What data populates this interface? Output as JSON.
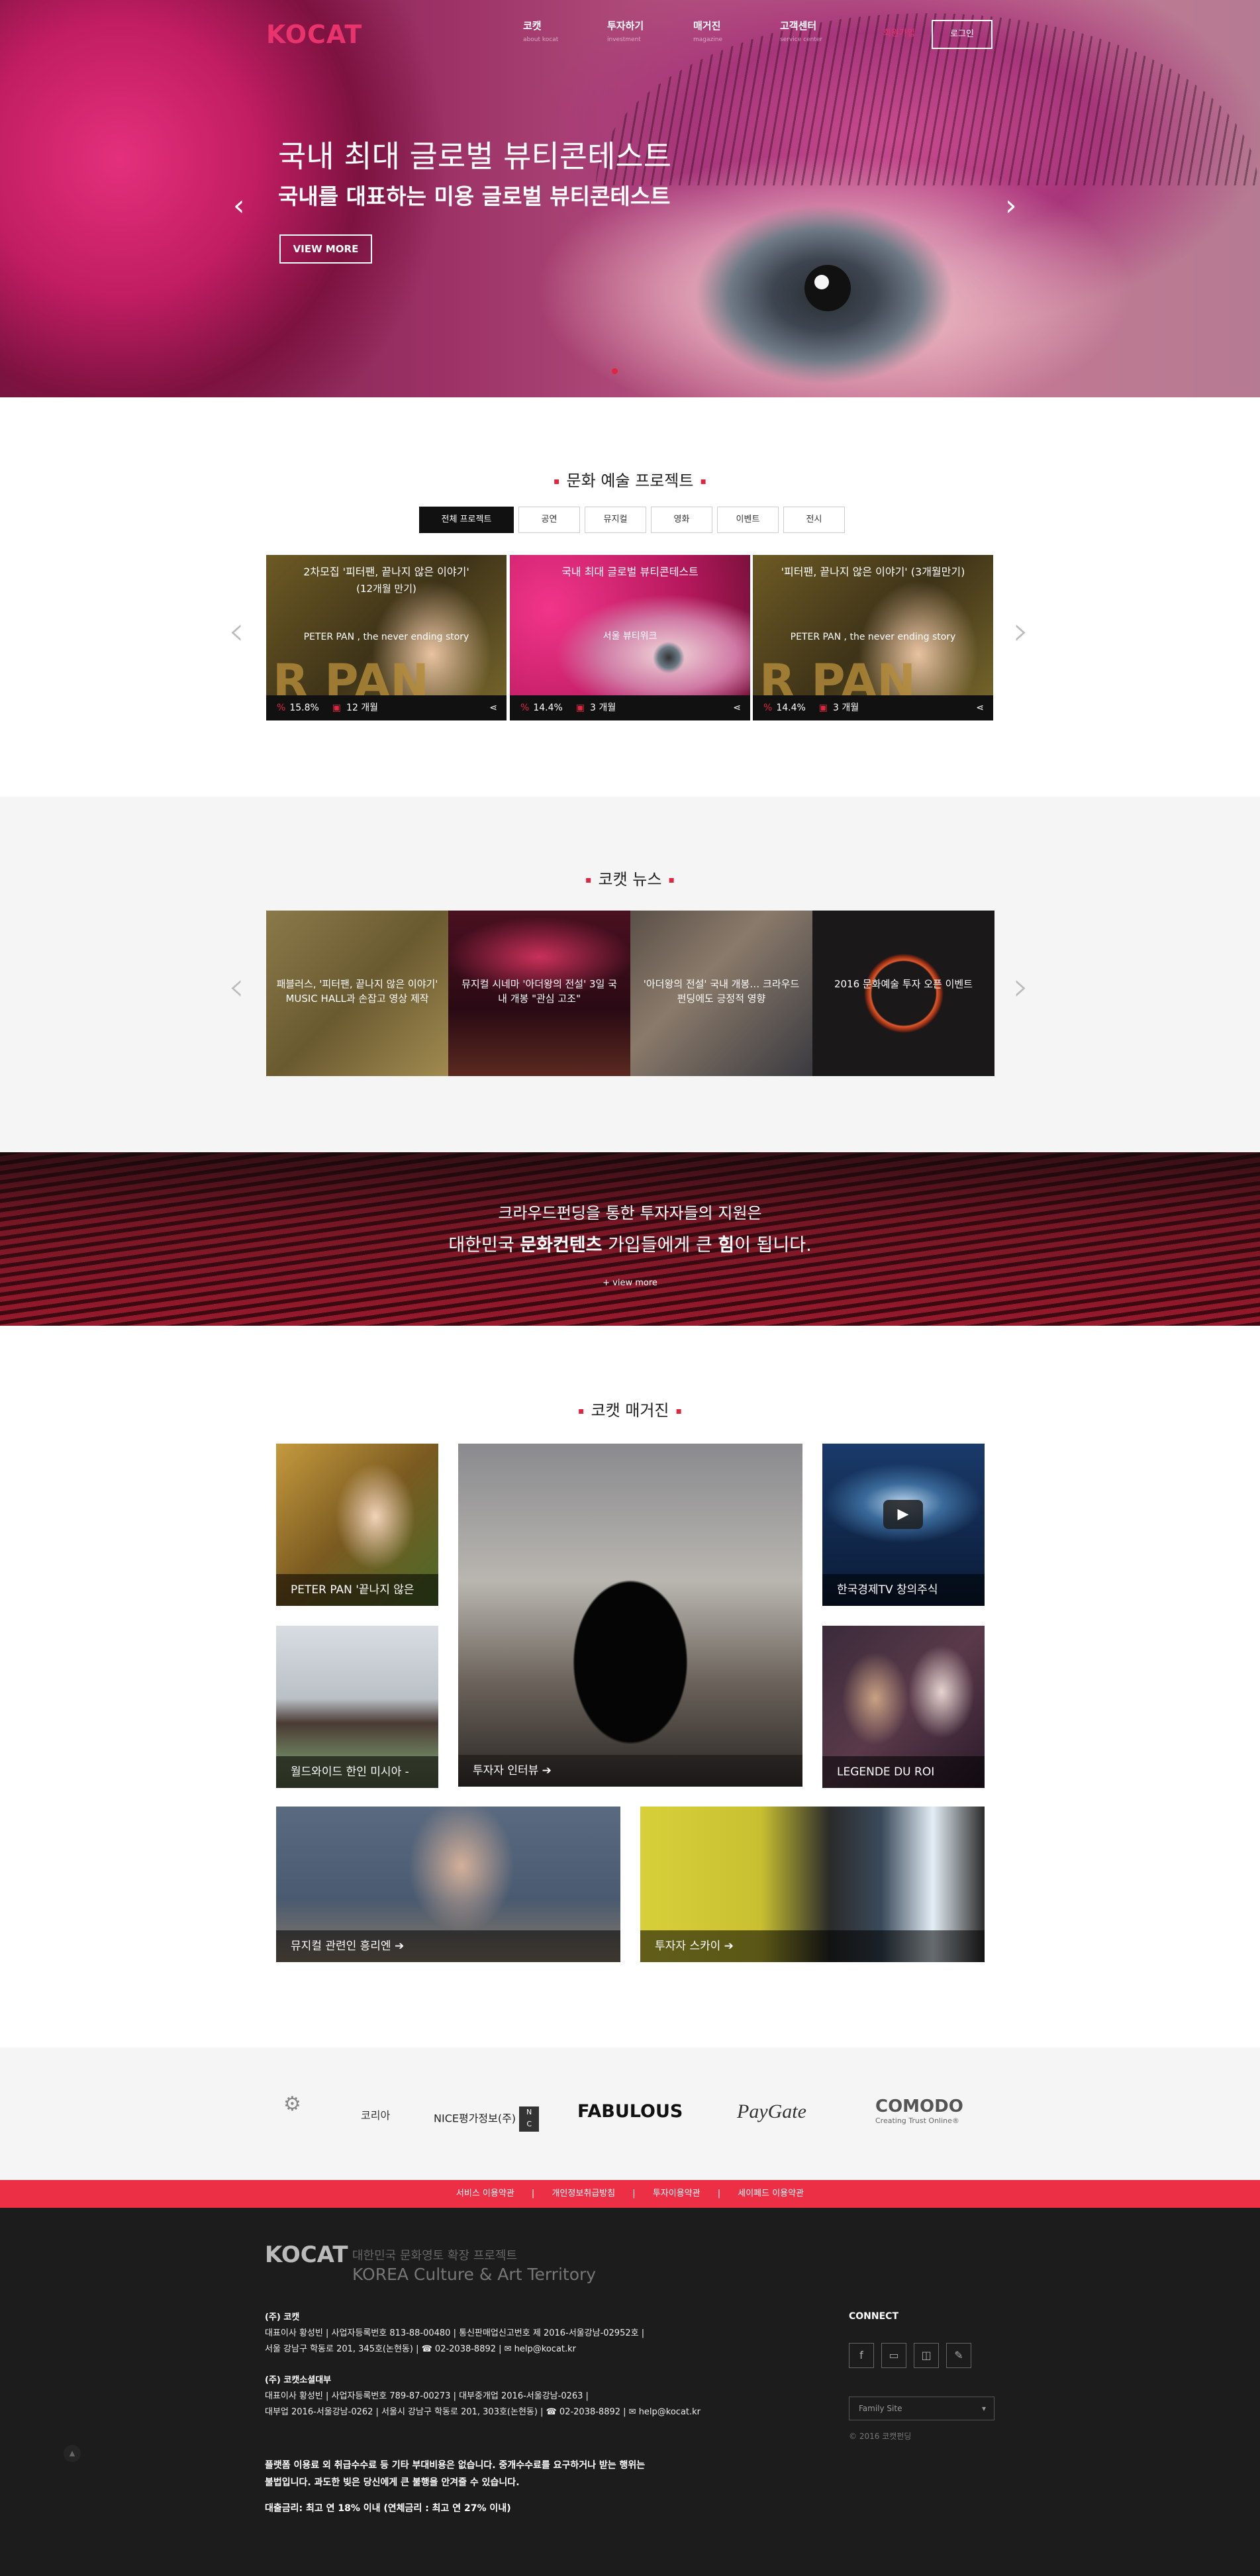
{
  "header": {
    "logo": "KOCAT",
    "nav": [
      {
        "label": "코캣",
        "sub": "about kocat"
      },
      {
        "label": "투자하기",
        "sub": "investment"
      },
      {
        "label": "매거진",
        "sub": "magazine"
      },
      {
        "label": "고객센터",
        "sub": "service center"
      }
    ],
    "join_label": "회원가입",
    "login_label": "로그인"
  },
  "hero": {
    "title": "국내 최대 글로벌 뷰티콘테스트",
    "subtitle": "국내를 대표하는 미용 글로벌 뷰티콘테스트",
    "cta": "VIEW MORE"
  },
  "projects": {
    "title": "문화 예술 프로젝트",
    "tabs": [
      "전체 프로젝트",
      "공연",
      "뮤지컬",
      "영화",
      "이벤트",
      "전시"
    ],
    "cards": [
      {
        "title": "2차모집 '피터팬, 끝나지 않은 이야기'",
        "sub": "(12개월 만기)",
        "desc": "PETER PAN , the never ending story",
        "rate": "15.8%",
        "period": "12 개월"
      },
      {
        "title": "국내 최대 글로벌 뷰티콘테스트",
        "sub": "",
        "desc": "서울 뷰티위크",
        "rate": "14.4%",
        "period": "3 개월"
      },
      {
        "title": "'피터팬, 끝나지 않은 이야기' (3개월만기)",
        "sub": "",
        "desc": "PETER PAN , the never ending story",
        "rate": "14.4%",
        "period": "3 개월"
      }
    ]
  },
  "news": {
    "title": "코캣 뉴스",
    "items": [
      "패블러스, '피터팬, 끝나지 않은 이야기' MUSIC HALL과 손잡고 영상 제작",
      "뮤지컬 시네마 '아더왕의 전설' 3일 국내 개봉 \"관심 고조\"",
      "'아더왕의 전설' 국내 개봉… 크라우드 펀딩에도 긍정적 영향",
      "2016 문화예술 투자 오픈 이벤트"
    ]
  },
  "banner": {
    "line1": "크라우드펀딩을 통한 투자자들의 지원은",
    "line2_pre": "대한민국 ",
    "line2_b1": "문화컨텐츠",
    "line2_mid": " 가입들에게 큰 ",
    "line2_b2": "힘",
    "line2_post": "이 됩니다.",
    "more": "+ view more"
  },
  "magazine": {
    "title": "코캣 매거진",
    "items": [
      "PETER PAN '끝나지 않은",
      "투자자 인터뷰",
      "한국경제TV 창의주식",
      "월드와이드 한인 미시아 -",
      "LEGENDE DU ROI",
      "뮤지컬 관련인 흥리엔",
      "투자자 스카이"
    ]
  },
  "partners": [
    "코리아",
    "NICE평가정보(주)",
    "FABULOUS",
    "PayGate",
    "COMODO"
  ],
  "partners_sub": {
    "comodo": "Creating Trust Online®"
  },
  "footer_links": [
    "서비스 이용약관",
    "개인정보취급방침",
    "투자이용약관",
    "세이페드 이용약관"
  ],
  "footer": {
    "logo": "KOCAT",
    "slogan_ko": "대한민국 문화영토 확장 프로젝트",
    "slogan_en": "KOREA Culture & Art Territory",
    "company1": {
      "name": "(주) 코캣",
      "l1": "대표이사 황성빈 | 사업자등록번호 813-88-00480 | 통신판매업신고번호 제 2016-서울강남-02952호 |",
      "l2": "서울 강남구 학동로 201, 345호(논현동) | ☎ 02-2038-8892 | ✉ help@kocat.kr"
    },
    "company2": {
      "name": "(주) 코캣소셜대부",
      "l1": "대표이사 황성빈 | 사업자등록번호 789-87-00273 | 대부중개업 2016-서울강남-0263 |",
      "l2": "대부업 2016-서울강남-0262 | 서울시 강남구 학동로 201, 303호(논현동) | ☎ 02-2038-8892 | ✉ help@kocat.kr"
    },
    "notice1": "플랫폼 이용료 외 취급수수료 등 기타 부대비용은 없습니다. 중개수수료를 요구하거나 받는 행위는",
    "notice2": "불법입니다. 과도한 빚은 당신에게 큰 불행을 안겨줄 수 있습니다.",
    "rate": "대출금리: 최고 연 18% 이내 (연체금리 : 최고 연 27% 이내)",
    "connect": "CONNECT",
    "family": "Family Site",
    "copyright": "© 2016 코캣펀딩"
  },
  "colors": {
    "accent": "#e0263e",
    "footer_bg": "#1c1c1c",
    "red_bar": "#ed2f45"
  }
}
